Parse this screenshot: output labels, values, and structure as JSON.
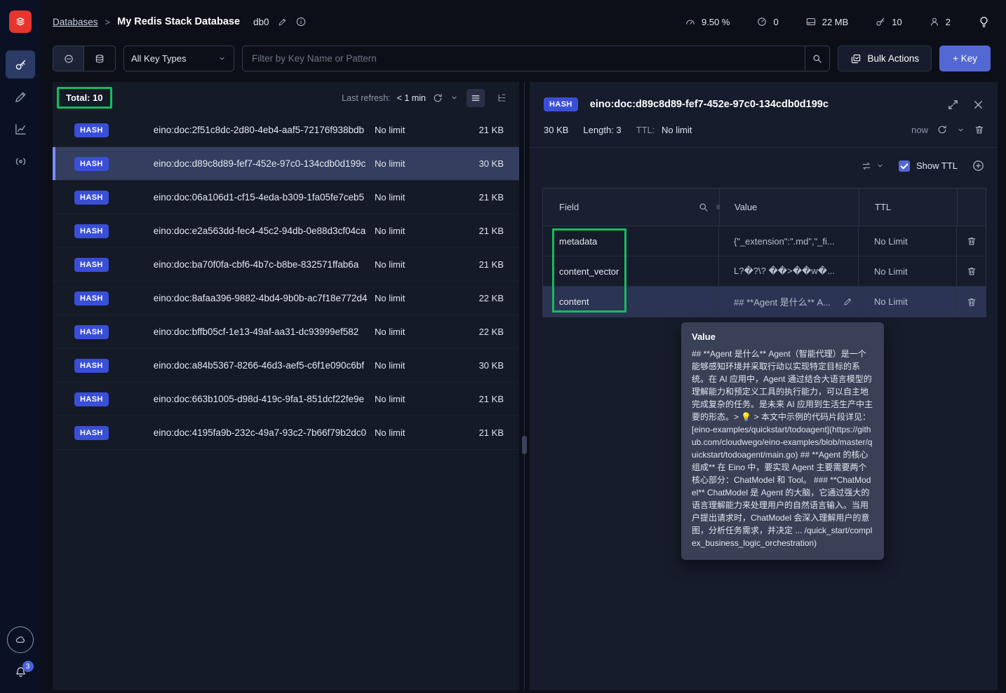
{
  "header": {
    "breadcrumb": {
      "databases_label": "Databases",
      "separator": ">",
      "database_name": "My Redis Stack Database",
      "db_index": "db0"
    },
    "stats": {
      "cpu": "9.50 %",
      "commands_per_sec": "0",
      "memory": "22 MB",
      "total_keys": "10",
      "connected_clients": "2"
    }
  },
  "filterbar": {
    "key_type_dropdown": "All Key Types",
    "search_placeholder": "Filter by Key Name or Pattern",
    "bulk_actions_label": "Bulk Actions",
    "add_key_label": "+ Key"
  },
  "key_list": {
    "total_label": "Total: 10",
    "last_refresh_label": "Last refresh:",
    "last_refresh_value": "< 1 min",
    "rows": [
      {
        "type": "HASH",
        "name": "eino:doc:2f51c8dc-2d80-4eb4-aaf5-72176f938bdb",
        "ttl": "No limit",
        "size": "21 KB",
        "selected": false
      },
      {
        "type": "HASH",
        "name": "eino:doc:d89c8d89-fef7-452e-97c0-134cdb0d199c",
        "ttl": "No limit",
        "size": "30 KB",
        "selected": true
      },
      {
        "type": "HASH",
        "name": "eino:doc:06a106d1-cf15-4eda-b309-1fa05fe7ceb5",
        "ttl": "No limit",
        "size": "21 KB",
        "selected": false
      },
      {
        "type": "HASH",
        "name": "eino:doc:e2a563dd-fec4-45c2-94db-0e88d3cf04ca",
        "ttl": "No limit",
        "size": "21 KB",
        "selected": false
      },
      {
        "type": "HASH",
        "name": "eino:doc:ba70f0fa-cbf6-4b7c-b8be-832571ffab6a",
        "ttl": "No limit",
        "size": "21 KB",
        "selected": false
      },
      {
        "type": "HASH",
        "name": "eino:doc:8afaa396-9882-4bd4-9b0b-ac7f18e772d4",
        "ttl": "No limit",
        "size": "22 KB",
        "selected": false
      },
      {
        "type": "HASH",
        "name": "eino:doc:bffb05cf-1e13-49af-aa31-dc93999ef582",
        "ttl": "No limit",
        "size": "22 KB",
        "selected": false
      },
      {
        "type": "HASH",
        "name": "eino:doc:a84b5367-8266-46d3-aef5-c6f1e090c6bf",
        "ttl": "No limit",
        "size": "30 KB",
        "selected": false
      },
      {
        "type": "HASH",
        "name": "eino:doc:663b1005-d98d-419c-9fa1-851dcf22fe9e",
        "ttl": "No limit",
        "size": "21 KB",
        "selected": false
      },
      {
        "type": "HASH",
        "name": "eino:doc:4195fa9b-232c-49a7-93c2-7b66f79b2dc0",
        "ttl": "No limit",
        "size": "21 KB",
        "selected": false
      }
    ]
  },
  "detail": {
    "type_badge": "HASH",
    "key_name": "eino:doc:d89c8d89-fef7-452e-97c0-134cdb0d199c",
    "size": "30 KB",
    "length": "Length: 3",
    "ttl_label": "TTL:",
    "ttl_value": "No limit",
    "refreshed": "now",
    "show_ttl_label": "Show TTL",
    "table": {
      "columns": [
        "Field",
        "Value",
        "TTL"
      ],
      "rows": [
        {
          "field": "metadata",
          "value": "{\"_extension\":\".md\",\"_fi...",
          "ttl": "No Limit",
          "selected": false,
          "editing": false
        },
        {
          "field": "content_vector",
          "value": "L?�?\\? ��>��w�...",
          "ttl": "No Limit",
          "selected": false,
          "editing": false
        },
        {
          "field": "content",
          "value": "## **Agent 是什么** A...",
          "ttl": "No Limit",
          "selected": true,
          "editing": true
        }
      ]
    },
    "tooltip": {
      "title": "Value",
      "text": "## **Agent 是什么** Agent（智能代理）是一个能够感知环境并采取行动以实现特定目标的系统。在 AI 应用中，Agent 通过结合大语言模型的理解能力和预定义工具的执行能力，可以自主地完成复杂的任务。是未来 AI 应用到生活生产中主要的形态。> 💡 > 本文中示例的代码片段详见：[eino-examples/quickstart/todoagent](https://github.com/cloudwego/eino-examples/blob/master/quickstart/todoagent/main.go) ## **Agent 的核心组成** 在 Eino 中，要实现 Agent 主要需要两个核心部分：ChatModel 和 Tool。 ### **ChatModel** ChatModel 是 Agent 的大脑，它通过强大的语言理解能力来处理用户的自然语言输入。当用户提出请求时，ChatModel 会深入理解用户的意图，分析任务需求，并决定 ... /quick_start/complex_business_logic_orchestration)"
    }
  },
  "sidebar": {
    "notification_count": "3"
  },
  "colors": {
    "accent_button": "#5468d4",
    "hash_badge": "#3a4fd7",
    "annotation_green": "#12bd5d",
    "logo_red": "#e6362e"
  },
  "icons": {
    "redis-logo": "red square with white stack",
    "browser-icon": "key",
    "workbench-icon": "pencil",
    "analytics-icon": "line-chart",
    "pubsub-icon": "broadcast",
    "search-icon": "magnifier",
    "refresh-icon": "circular-arrow",
    "trash-icon": "trash-can",
    "edit-icon": "pencil",
    "close-icon": "x",
    "expand-icon": "open-in-full",
    "lightbulb-icon": "bulb"
  }
}
